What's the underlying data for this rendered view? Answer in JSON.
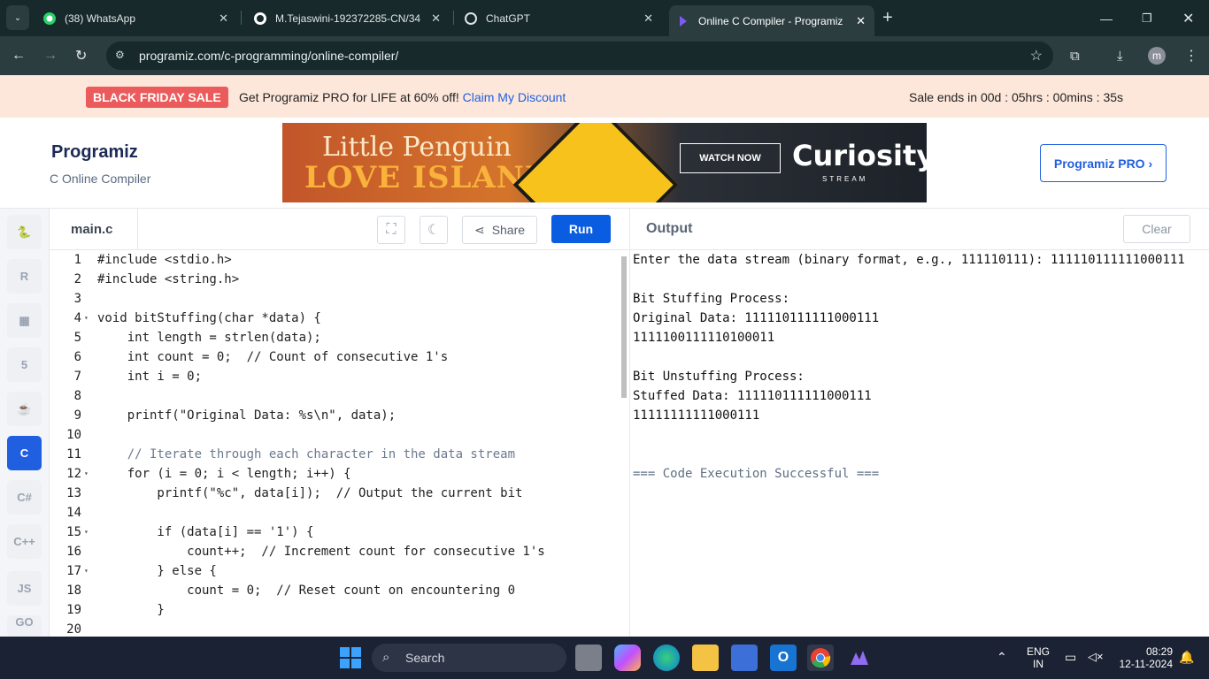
{
  "browser": {
    "tabs": [
      {
        "label": "(38) WhatsApp"
      },
      {
        "label": "M.Tejaswini-192372285-CN/34"
      },
      {
        "label": "ChatGPT"
      },
      {
        "label": "Online C Compiler - Programiz"
      }
    ],
    "url": "programiz.com/c-programming/online-compiler/",
    "profile_initial": "m"
  },
  "banner": {
    "sale_badge": "BLACK FRIDAY SALE",
    "promo_text": "Get Programiz PRO for LIFE at 60% off!",
    "promo_link": "Claim My Discount",
    "sale_ends": "Sale ends in 00d : 05hrs : 00mins : 35s"
  },
  "header": {
    "logo": "Programiz",
    "subtitle": "C Online Compiler",
    "pro_button": "Programiz PRO ›"
  },
  "ad": {
    "line1": "Little Penguin",
    "line2": "LOVE ISLAND",
    "watch": "WATCH NOW",
    "brand": "Curiosity",
    "brand_sub": "STREAM"
  },
  "sidebar": {
    "items": [
      "python",
      "R",
      "sql",
      "html",
      "java",
      "C",
      "C#",
      "C++",
      "JS",
      "GO"
    ]
  },
  "editor": {
    "filename": "main.c",
    "share_label": "Share",
    "run_label": "Run",
    "lines": [
      {
        "n": "1",
        "text": "#include <stdio.h>"
      },
      {
        "n": "2",
        "text": "#include <string.h>"
      },
      {
        "n": "3",
        "text": ""
      },
      {
        "n": "4",
        "text": "void bitStuffing(char *data) {"
      },
      {
        "n": "5",
        "text": "    int length = strlen(data);"
      },
      {
        "n": "6",
        "text": "    int count = 0;  // Count of consecutive 1's"
      },
      {
        "n": "7",
        "text": "    int i = 0;"
      },
      {
        "n": "8",
        "text": ""
      },
      {
        "n": "9",
        "text": "    printf(\"Original Data: %s\\n\", data);"
      },
      {
        "n": "10",
        "text": ""
      },
      {
        "n": "11",
        "text": "    // Iterate through each character in the data stream"
      },
      {
        "n": "12",
        "text": "    for (i = 0; i < length; i++) {"
      },
      {
        "n": "13",
        "text": "        printf(\"%c\", data[i]);  // Output the current bit"
      },
      {
        "n": "14",
        "text": ""
      },
      {
        "n": "15",
        "text": "        if (data[i] == '1') {"
      },
      {
        "n": "16",
        "text": "            count++;  // Increment count for consecutive 1's"
      },
      {
        "n": "17",
        "text": "        } else {"
      },
      {
        "n": "18",
        "text": "            count = 0;  // Reset count on encountering 0"
      },
      {
        "n": "19",
        "text": "        }"
      },
      {
        "n": "20",
        "text": ""
      }
    ]
  },
  "output": {
    "title": "Output",
    "clear_label": "Clear",
    "lines": [
      "Enter the data stream (binary format, e.g., 111110111): 111110111111000111",
      "",
      "Bit Stuffing Process:",
      "Original Data: 111110111111000111",
      "1111100111110100011",
      "",
      "Bit Unstuffing Process:",
      "Stuffed Data: 111110111111000111",
      "11111111111000111",
      "",
      "",
      "=== Code Execution Successful ==="
    ]
  },
  "taskbar": {
    "search": "Search",
    "lang_top": "ENG",
    "lang_bottom": "IN",
    "time": "08:29",
    "date": "12-11-2024"
  }
}
